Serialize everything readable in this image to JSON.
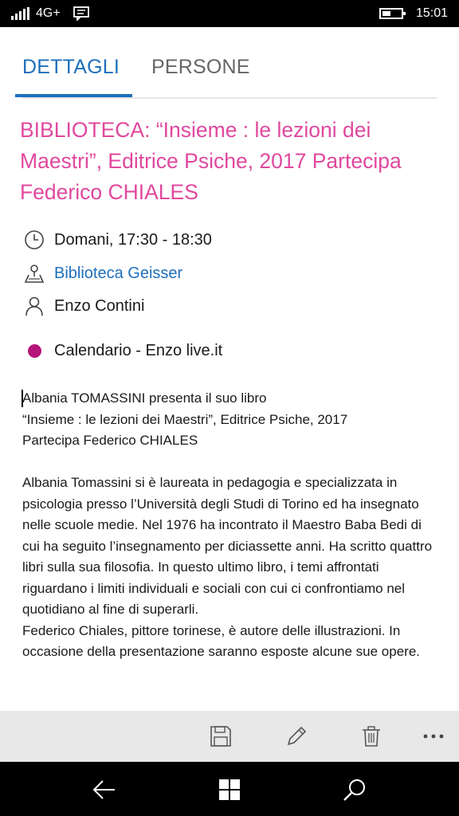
{
  "status_bar": {
    "network": "4G+",
    "time": "15:01"
  },
  "tabs": [
    {
      "label": "DETTAGLI",
      "active": true
    },
    {
      "label": "PERSONE",
      "active": false
    }
  ],
  "event": {
    "title": "BIBLIOTECA: “Insieme : le lezioni dei Maestri”, Editrice Psiche, 2017 Partecipa Federico CHIALES",
    "time": "Domani, 17:30 - 18:30",
    "location": "Biblioteca Geisser",
    "organizer": "Enzo Contini",
    "calendar": "Calendario - Enzo live.it",
    "calendar_color": "#b5147a",
    "description": "Albania TOMASSINI presenta il suo libro\n“Insieme : le lezioni dei Maestri”, Editrice Psiche, 2017\nPartecipa Federico CHIALES\n\nAlbania Tomassini si è laureata in pedagogia e specializzata in psicologia presso l’Università degli Studi di Torino ed ha insegnato nelle scuole medie. Nel 1976 ha incontrato il Maestro Baba Bedi di cui ha seguito l’insegnamento per diciassette anni. Ha scritto quattro libri sulla sua filosofia. In questo ultimo libro, i temi affrontati riguardano i limiti individuali e sociali con cui ci confrontiamo nel quotidiano al fine di superarli.\nFederico Chiales, pittore torinese, è autore delle illustrazioni. In occasione della presentazione saranno esposte alcune sue opere."
  },
  "command_bar": {
    "icons": [
      "save-icon",
      "edit-icon",
      "delete-icon",
      "more-icon"
    ]
  },
  "nav_bar": {
    "icons": [
      "back-icon",
      "windows-icon",
      "search-icon"
    ]
  },
  "colors": {
    "accent": "#1e6fba",
    "title": "#e0489e"
  }
}
